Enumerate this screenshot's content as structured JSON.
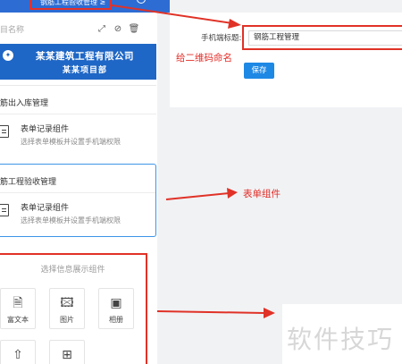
{
  "topbar": {
    "tab_label": "钢筋工程验收管理 ≥"
  },
  "name_row": {
    "label": "目名称",
    "icons": [
      "expand-icon",
      "ban-icon",
      "trash-icon"
    ]
  },
  "banner": {
    "title": "某某建筑工程有限公司",
    "subtitle": "某某项目部"
  },
  "sections": [
    {
      "title": "筋出入库管理",
      "component_title": "表单记录组件",
      "component_sub": "选择表单模板并设置手机端权限"
    },
    {
      "title": "筋工程验收管理",
      "component_title": "表单记录组件",
      "component_sub": "选择表单模板并设置手机端权限"
    }
  ],
  "picker": {
    "title": "选择信息展示组件",
    "tiles": [
      {
        "label": "富文本",
        "icon": "document-icon"
      },
      {
        "label": "图片",
        "icon": "image-icon"
      },
      {
        "label": "相册",
        "icon": "album-icon"
      },
      {
        "label": "",
        "icon": "upload-icon"
      },
      {
        "label": "",
        "icon": "grid-icon"
      }
    ]
  },
  "form": {
    "label": "手机端标题:",
    "value": "钢筋工程管理",
    "save_label": "保存"
  },
  "annotations": {
    "qr_note": "给二维码命名",
    "form_note": "表单组件"
  },
  "watermark": "软件技巧",
  "colors": {
    "accent_red": "#e03227",
    "brand_blue": "#1f67c6",
    "button_blue": "#1e88e5"
  }
}
